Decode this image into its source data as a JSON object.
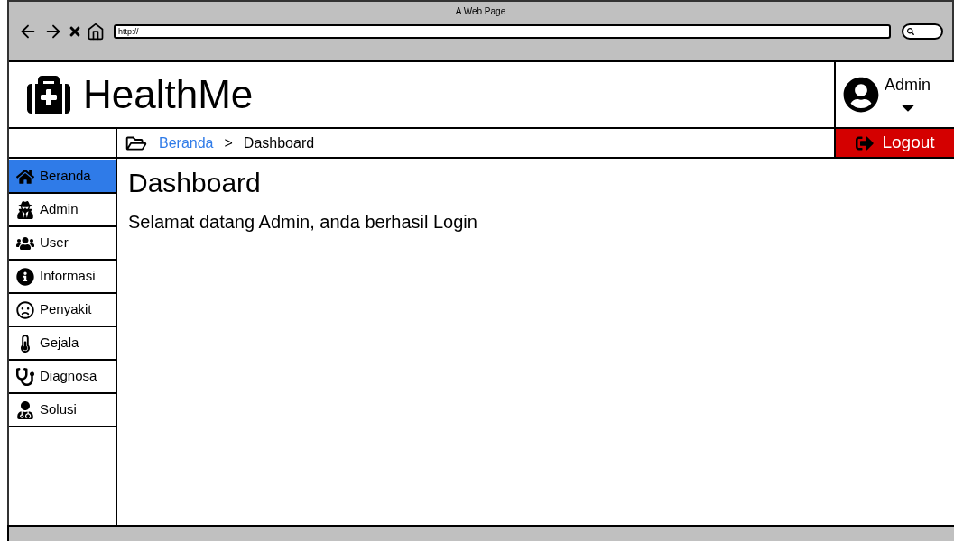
{
  "window": {
    "title": "A Web Page",
    "address": "http://"
  },
  "header": {
    "logo": "HealthMe",
    "user": "Admin"
  },
  "breadcrumb": [
    {
      "label": "Beranda",
      "kind": "link"
    },
    {
      "label": ">",
      "kind": "separator"
    },
    {
      "label": "Dashboard",
      "kind": "current"
    }
  ],
  "logout": "Logout",
  "sidebar": {
    "items": [
      {
        "label": "Beranda",
        "kind": "home",
        "selected": true
      },
      {
        "label": "Admin",
        "kind": "spy",
        "selected": false
      },
      {
        "label": "User",
        "kind": "users",
        "selected": false
      },
      {
        "label": "Informasi",
        "kind": "info",
        "selected": false
      },
      {
        "label": "Penyakit",
        "kind": "frown",
        "selected": false
      },
      {
        "label": "Gejala",
        "kind": "thermometer",
        "selected": false
      },
      {
        "label": "Diagnosa",
        "kind": "stethoscope",
        "selected": false
      },
      {
        "label": "Solusi",
        "kind": "doctor",
        "selected": false
      }
    ]
  },
  "content": {
    "title": "Dashboard",
    "message": "Selamat datang Admin, anda berhasil Login"
  }
}
